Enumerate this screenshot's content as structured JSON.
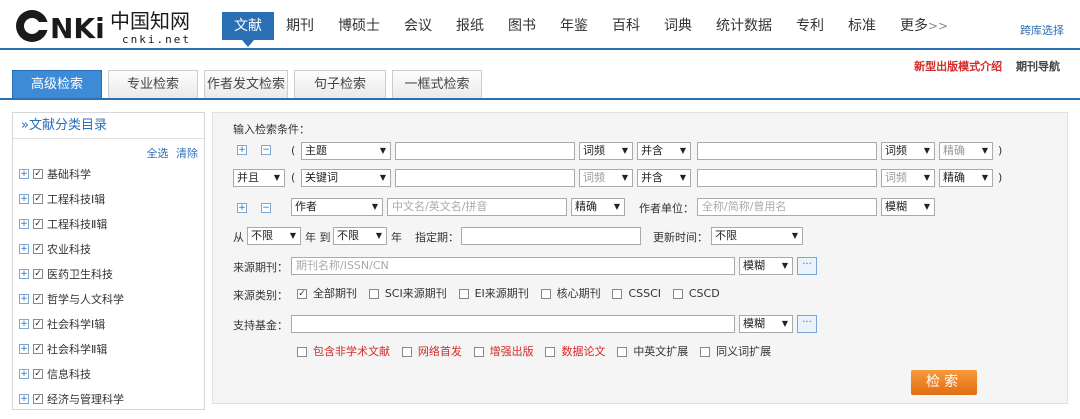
{
  "logo": {
    "brand_cn": "中国知网",
    "brand_en": "cnki.net"
  },
  "nav": {
    "items": [
      "文献",
      "期刊",
      "博硕士",
      "会议",
      "报纸",
      "图书",
      "年鉴",
      "百科",
      "词典",
      "统计数据",
      "专利",
      "标准",
      "更多"
    ],
    "more_arrow": ">>",
    "cross_library": "跨库选择"
  },
  "tabs": [
    "高级检索",
    "专业检索",
    "作者发文检索",
    "句子检索",
    "一框式检索"
  ],
  "toplinks": {
    "new_mode": "新型出版模式介绍",
    "journal_nav": "期刊导航"
  },
  "sidebar": {
    "title": "»文献分类目录",
    "select_all": "全选",
    "clear": "清除",
    "categories": [
      "基础科学",
      "工程科技Ⅰ辑",
      "工程科技Ⅱ辑",
      "农业科技",
      "医药卫生科技",
      "哲学与人文科学",
      "社会科学Ⅰ辑",
      "社会科学Ⅱ辑",
      "信息科技",
      "经济与管理科学"
    ]
  },
  "form": {
    "input_label": "输入检索条件：",
    "row1": {
      "paren_open": "(",
      "field": "主题",
      "freq": "词频",
      "bool": "并含",
      "freq2": "词频",
      "match": "精确",
      "paren_close": ")"
    },
    "row2": {
      "logic": "并且",
      "paren_open": "(",
      "field": "关键词",
      "freq": "词频",
      "bool": "并含",
      "freq2": "词频",
      "match": "精确",
      "paren_close": ")"
    },
    "row3": {
      "field": "作者",
      "placeholder": "中文名/英文名/拼音",
      "match": "精确",
      "unit_label": "作者单位：",
      "unit_placeholder": "全称/简称/曾用名",
      "unit_match": "模糊"
    },
    "row4": {
      "from": "从",
      "from_val": "不限",
      "year_to": "年 到",
      "to_val": "不限",
      "year": "年",
      "date_label": "指定期：",
      "update_label": "更新时间：",
      "update_val": "不限"
    },
    "row5": {
      "label": "来源期刊：",
      "placeholder": "期刊名称/ISSN/CN",
      "match": "模糊",
      "dots": "···"
    },
    "row6": {
      "label": "来源类别：",
      "options": [
        "全部期刊",
        "SCI来源期刊",
        "EI来源期刊",
        "核心期刊",
        "CSSCI",
        "CSCD"
      ]
    },
    "row7": {
      "label": "支持基金：",
      "match": "模糊",
      "dots": "···"
    },
    "extras": {
      "red": [
        "包含非学术文献",
        "网络首发",
        "增强出版",
        "数据论文"
      ],
      "normal": [
        "中英文扩展",
        "同义词扩展"
      ]
    },
    "search_button": "检索"
  },
  "icons": {
    "plus": "+",
    "minus": "−",
    "check": "✓"
  }
}
